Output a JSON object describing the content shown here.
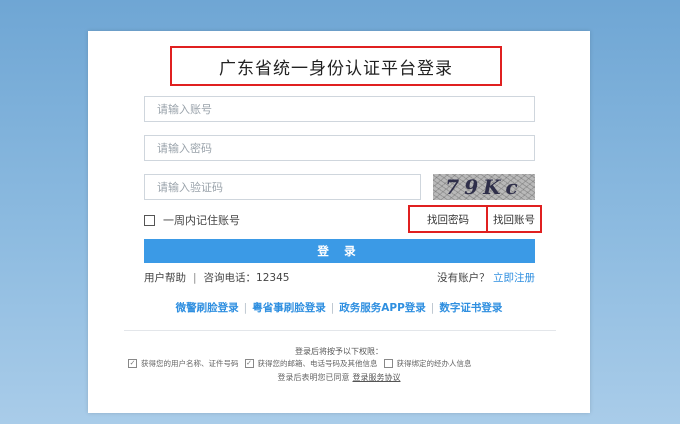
{
  "title": "广东省统一身份认证平台登录",
  "form": {
    "account_placeholder": "请输入账号",
    "password_placeholder": "请输入密码",
    "captcha_placeholder": "请输入验证码",
    "captcha_text": "79Kc"
  },
  "remember_label": "一周内记住账号",
  "find_password": "找回密码",
  "find_account": "找回账号",
  "login_button": "登 录",
  "help": {
    "user_help": "用户帮助",
    "separator": "|",
    "phone_label": "咨询电话：",
    "phone": "12345",
    "no_account": "没有账户？",
    "register": "立即注册"
  },
  "alt_logins": [
    "微警刷脸登录",
    "粤省事刷脸登录",
    "政务服务APP登录",
    "数字证书登录"
  ],
  "alt_divider": "|",
  "permissions": {
    "title": "登录后将按予以下权限：",
    "items": [
      {
        "label": "获得您的用户名称、证件号码",
        "checked": true
      },
      {
        "label": "获得您的邮箱、电话号码及其他信息",
        "checked": true
      },
      {
        "label": "获得绑定的经办人信息",
        "checked": false
      }
    ],
    "check_mark": "✓"
  },
  "agreement": {
    "prefix": "登录后表明您已同意",
    "link": "登录服务协议"
  },
  "colors": {
    "accent": "#3b9ae6",
    "link": "#2f8fe0",
    "highlight_border": "#e02020"
  }
}
